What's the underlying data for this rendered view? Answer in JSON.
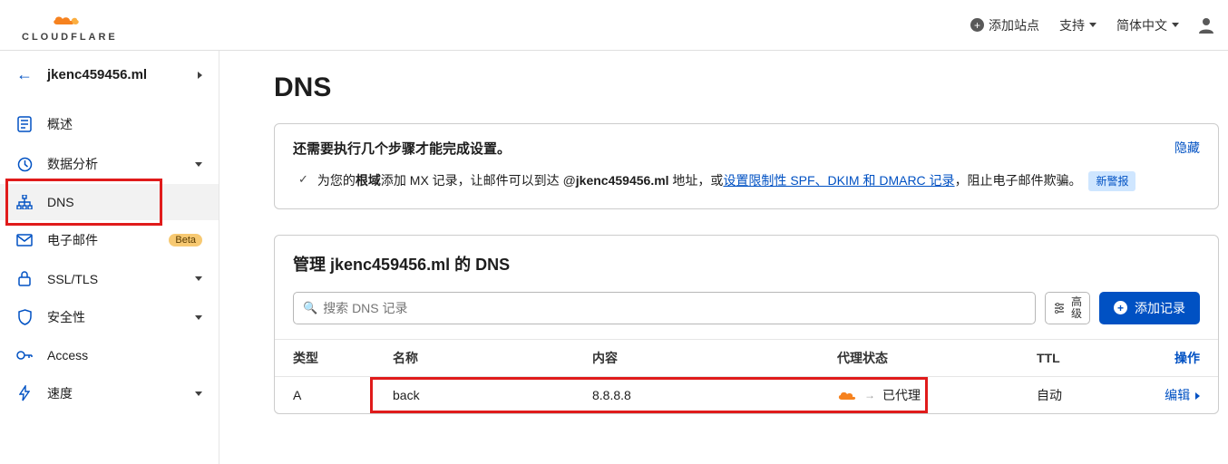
{
  "brand": {
    "name": "CLOUDFLARE"
  },
  "topbar": {
    "add_site": "添加站点",
    "support": "支持",
    "language": "简体中文"
  },
  "site": {
    "domain": "jkenc459456.ml"
  },
  "sidebar": {
    "items": [
      {
        "label": "概述"
      },
      {
        "label": "数据分析"
      },
      {
        "label": "DNS"
      },
      {
        "label": "电子邮件",
        "badge": "Beta"
      },
      {
        "label": "SSL/TLS"
      },
      {
        "label": "安全性"
      },
      {
        "label": "Access"
      },
      {
        "label": "速度"
      }
    ]
  },
  "page": {
    "title": "DNS",
    "setup": {
      "heading": "还需要执行几个步骤才能完成设置。",
      "hide": "隐藏",
      "line_prefix": "为您的",
      "root_word": "根域",
      "line_mid1": "添加 MX 记录，让邮件可以到达 @",
      "domain_bold": "jkenc459456.ml",
      "line_mid2": " 地址，或",
      "link_text": "设置限制性 SPF、DKIM 和 DMARC 记录",
      "line_end": "，阻止电子邮件欺骗。",
      "new_alert": "新警报"
    },
    "mgmt_prefix": "管理 ",
    "mgmt_domain": "jkenc459456.ml",
    "mgmt_suffix": " 的 DNS",
    "search_placeholder": "搜索 DNS 记录",
    "advanced": "高级",
    "add_record": "添加记录",
    "columns": {
      "type": "类型",
      "name": "名称",
      "content": "内容",
      "proxy": "代理状态",
      "ttl": "TTL",
      "ops": "操作"
    },
    "records": [
      {
        "type": "A",
        "name": "back",
        "content": "8.8.8.8",
        "proxy": "已代理",
        "ttl": "自动",
        "edit": "编辑"
      }
    ]
  }
}
